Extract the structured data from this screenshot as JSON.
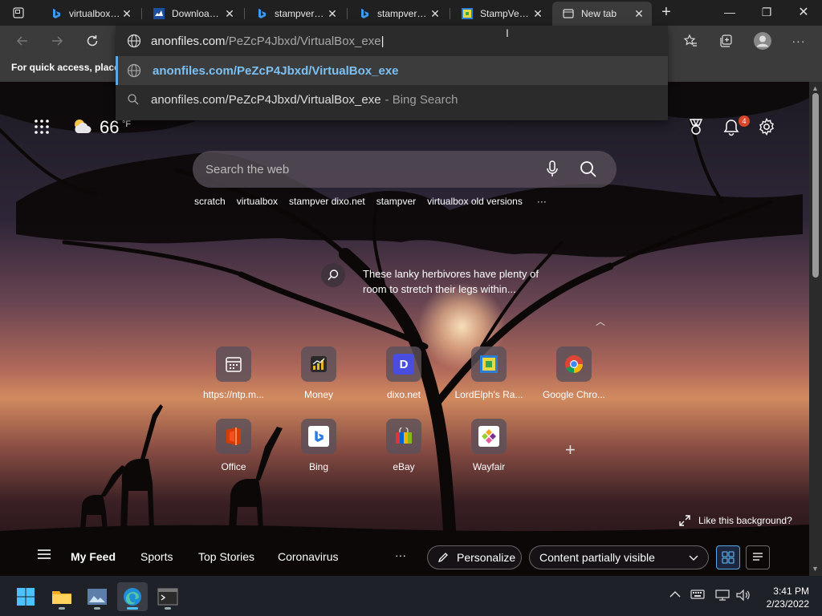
{
  "tabs": [
    {
      "title": "virtualbox old versions",
      "favicon": "bing-icon"
    },
    {
      "title": "Download_Old_Builds",
      "favicon": "document-icon"
    },
    {
      "title": "stampver - Bing",
      "favicon": "bing-icon"
    },
    {
      "title": "stampver - Bing",
      "favicon": "bing-icon"
    },
    {
      "title": "StampVer - dixo.net",
      "favicon": "stampver-icon"
    },
    {
      "title": "New tab",
      "favicon": "newtab-icon"
    }
  ],
  "window": {
    "minimize": "—",
    "maximize": "❐",
    "close": "✕",
    "newtab": "+"
  },
  "favbar": {
    "hint": "For quick access, place y"
  },
  "omnibox": {
    "domain": "anonfiles.com",
    "path": "/PeZcP4Jbxd/VirtualBox_exe",
    "suggestions": [
      {
        "text": "anonfiles.com/PeZcP4Jbxd/VirtualBox_exe",
        "sub": ""
      },
      {
        "text": "anonfiles.com/PeZcP4Jbxd/VirtualBox_exe",
        "sub": "- Bing Search"
      }
    ]
  },
  "weather": {
    "temp": "66",
    "unit": "°F"
  },
  "notifications": {
    "count": "4"
  },
  "search": {
    "placeholder": "Search the web"
  },
  "quick_links": [
    "scratch",
    "virtualbox",
    "stampver dixo.net",
    "stampver",
    "virtualbox old versions"
  ],
  "more_glyph": "···",
  "image_info": {
    "text": "These lanky herbivores have plenty of room to stretch their legs within..."
  },
  "tiles": [
    {
      "label": "https://ntp.m...",
      "icon": "calendar-icon"
    },
    {
      "label": "Money",
      "icon": "money-icon"
    },
    {
      "label": "dixo.net",
      "icon": "dixo-icon",
      "letter": "D"
    },
    {
      "label": "LordElph's Ra...",
      "icon": "lordelph-icon"
    },
    {
      "label": "Google Chro...",
      "icon": "chrome-icon"
    },
    {
      "label": "Office",
      "icon": "office-icon"
    },
    {
      "label": "Bing",
      "icon": "bing-icon"
    },
    {
      "label": "eBay",
      "icon": "ebay-icon"
    },
    {
      "label": "Wayfair",
      "icon": "wayfair-icon"
    }
  ],
  "like_bg": "Like this background?",
  "feed": {
    "tabs": [
      "My Feed",
      "Sports",
      "Top Stories",
      "Coronavirus"
    ],
    "personalize": "Personalize",
    "content_visibility": "Content partially visible"
  },
  "clock": {
    "time": "3:41 PM",
    "date": "2/23/2022"
  },
  "colors": {
    "accent": "#5aa9e6",
    "badge": "#d9472b",
    "taskbar": "#1f2128"
  }
}
